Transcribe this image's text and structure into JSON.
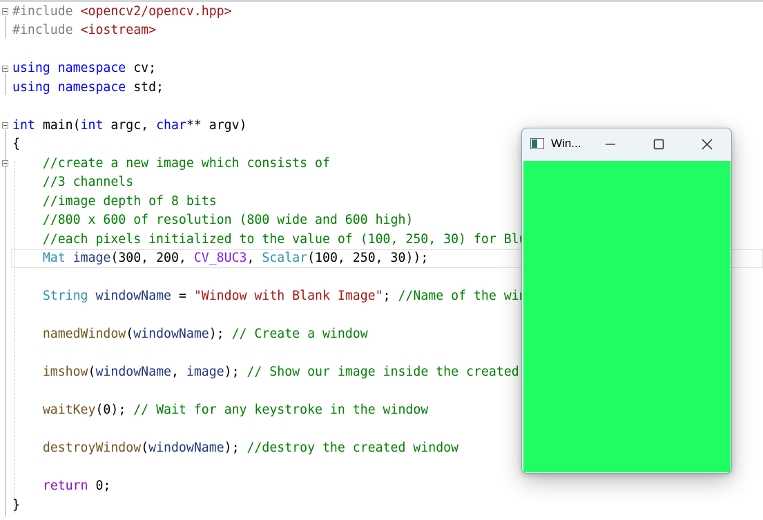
{
  "window": {
    "title": "Win...",
    "image_color": "#1ffd63"
  },
  "code_lines": [
    [
      {
        "t": "#include ",
        "c": "pp"
      },
      {
        "t": "<opencv2/opencv.hpp>",
        "c": "inc"
      }
    ],
    [
      {
        "t": "#include ",
        "c": "pp"
      },
      {
        "t": "<iostream>",
        "c": "inc"
      }
    ],
    [],
    [
      {
        "t": "using namespace ",
        "c": "kw"
      },
      {
        "t": "cv;",
        "c": ""
      }
    ],
    [
      {
        "t": "using namespace ",
        "c": "kw"
      },
      {
        "t": "std;",
        "c": ""
      }
    ],
    [],
    [
      {
        "t": "int ",
        "c": "kw"
      },
      {
        "t": "main(",
        "c": ""
      },
      {
        "t": "int ",
        "c": "kw"
      },
      {
        "t": "argc, ",
        "c": ""
      },
      {
        "t": "char",
        "c": "kw"
      },
      {
        "t": "** argv)",
        "c": ""
      }
    ],
    [
      {
        "t": "{",
        "c": ""
      }
    ],
    [
      {
        "t": "    //create a new image which consists of",
        "c": "cm"
      }
    ],
    [
      {
        "t": "    //3 channels",
        "c": "cm"
      }
    ],
    [
      {
        "t": "    //image depth of 8 bits",
        "c": "cm"
      }
    ],
    [
      {
        "t": "    //800 x 600 of resolution (800 wide and 600 high)",
        "c": "cm"
      }
    ],
    [
      {
        "t": "    //each pixels initialized to the value of (100, 250, 30) for Blue, Green and Red planes re",
        "c": "cm"
      }
    ],
    [
      {
        "t": "    ",
        "c": ""
      },
      {
        "t": "Mat ",
        "c": "ty"
      },
      {
        "t": "image",
        "c": "pa"
      },
      {
        "t": "(300, 200, ",
        "c": ""
      },
      {
        "t": "CV_8UC3",
        "c": "mac"
      },
      {
        "t": ", ",
        "c": ""
      },
      {
        "t": "Scalar",
        "c": "ty"
      },
      {
        "t": "(100, 250, 30));",
        "c": ""
      }
    ],
    [],
    [
      {
        "t": "    ",
        "c": ""
      },
      {
        "t": "String ",
        "c": "ty"
      },
      {
        "t": "windowName",
        "c": "pa"
      },
      {
        "t": " = ",
        "c": ""
      },
      {
        "t": "\"Window with Blank Image\"",
        "c": "str"
      },
      {
        "t": "; ",
        "c": ""
      },
      {
        "t": "//Name of the window",
        "c": "cm"
      }
    ],
    [],
    [
      {
        "t": "    ",
        "c": ""
      },
      {
        "t": "namedWindow",
        "c": "fn"
      },
      {
        "t": "(",
        "c": ""
      },
      {
        "t": "windowName",
        "c": "pa"
      },
      {
        "t": "); ",
        "c": ""
      },
      {
        "t": "// Create a window",
        "c": "cm"
      }
    ],
    [],
    [
      {
        "t": "    ",
        "c": ""
      },
      {
        "t": "imshow",
        "c": "fn"
      },
      {
        "t": "(",
        "c": ""
      },
      {
        "t": "windowName",
        "c": "pa"
      },
      {
        "t": ", ",
        "c": ""
      },
      {
        "t": "image",
        "c": "pa"
      },
      {
        "t": "); ",
        "c": ""
      },
      {
        "t": "// Show our image inside the created window.",
        "c": "cm"
      }
    ],
    [],
    [
      {
        "t": "    ",
        "c": ""
      },
      {
        "t": "waitKey",
        "c": "fn"
      },
      {
        "t": "(0); ",
        "c": ""
      },
      {
        "t": "// Wait for any keystroke in the window",
        "c": "cm"
      }
    ],
    [],
    [
      {
        "t": "    ",
        "c": ""
      },
      {
        "t": "destroyWindow",
        "c": "fn"
      },
      {
        "t": "(",
        "c": ""
      },
      {
        "t": "windowName",
        "c": "pa"
      },
      {
        "t": "); ",
        "c": ""
      },
      {
        "t": "//destroy the created window",
        "c": "cm"
      }
    ],
    [],
    [
      {
        "t": "    ",
        "c": ""
      },
      {
        "t": "return ",
        "c": "ret"
      },
      {
        "t": "0;",
        "c": ""
      }
    ],
    [
      {
        "t": "}",
        "c": ""
      }
    ]
  ]
}
